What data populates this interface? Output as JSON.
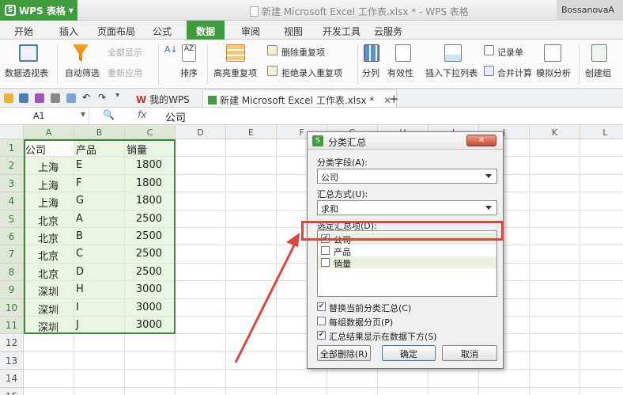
{
  "app": {
    "name": "WPS 表格",
    "window_title": "新建 Microsoft Excel 工作表.xlsx * - WPS 表格",
    "user": "BossanovaA"
  },
  "menu": [
    "开始",
    "插入",
    "页面布局",
    "公式",
    "数据",
    "审阅",
    "视图",
    "开发工具",
    "云服务"
  ],
  "ribbon": {
    "pivot": "数据透视表",
    "autofilter": "自动筛选",
    "show_all": "全部显示",
    "reapply": "重新应用",
    "sort": "排序",
    "highlight_dup": "高亮重复项",
    "remove_dup": "删除重复项",
    "reject_dup": "拒绝录入重复项",
    "split": "分列",
    "validity": "有效性",
    "insert_dropdown": "插入下拉列表",
    "record": "记录单",
    "merge_calc": "合并计算",
    "simulate": "模拟分析",
    "group": "创建组"
  },
  "tabs": {
    "my_wps": "我的WPS",
    "doc": "新建 Microsoft Excel 工作表.xlsx *",
    "add": "+"
  },
  "formula_bar": {
    "cell": "A1",
    "fx": "fx",
    "value": "公司"
  },
  "columns": [
    "A",
    "B",
    "C",
    "D",
    "E",
    "F",
    "G",
    "H",
    "I",
    "J",
    "K",
    "L"
  ],
  "rows": [
    "1",
    "2",
    "3",
    "4",
    "5",
    "6",
    "7",
    "8",
    "9",
    "10",
    "11",
    "12",
    "13",
    "14",
    "15"
  ],
  "table": [
    [
      "公司",
      "产品",
      "销量"
    ],
    [
      "上海",
      "E",
      "1800"
    ],
    [
      "上海",
      "F",
      "1800"
    ],
    [
      "上海",
      "G",
      "1800"
    ],
    [
      "北京",
      "A",
      "2500"
    ],
    [
      "北京",
      "B",
      "2500"
    ],
    [
      "北京",
      "C",
      "2500"
    ],
    [
      "北京",
      "D",
      "2500"
    ],
    [
      "深圳",
      "H",
      "3000"
    ],
    [
      "深圳",
      "I",
      "3000"
    ],
    [
      "深圳",
      "J",
      "3000"
    ]
  ],
  "dialog": {
    "title": "分类汇总",
    "field_label": "分类字段(A):",
    "field_value": "公司",
    "method_label": "汇总方式(U):",
    "method_value": "求和",
    "items_label": "选定汇总项(D):",
    "items": [
      {
        "label": "公司",
        "checked": true
      },
      {
        "label": "产品",
        "checked": false
      },
      {
        "label": "销量",
        "checked": false
      }
    ],
    "options": [
      {
        "label": "替换当前分类汇总(C)",
        "checked": true
      },
      {
        "label": "每组数据分页(P)",
        "checked": false
      },
      {
        "label": "汇总结果显示在数据下方(S)",
        "checked": true
      }
    ],
    "btn_remove_all": "全部删除(R)",
    "btn_ok": "确定",
    "btn_cancel": "取消"
  },
  "colors": {
    "accent": "#3f9c3f",
    "highlight": "#e0453a"
  }
}
